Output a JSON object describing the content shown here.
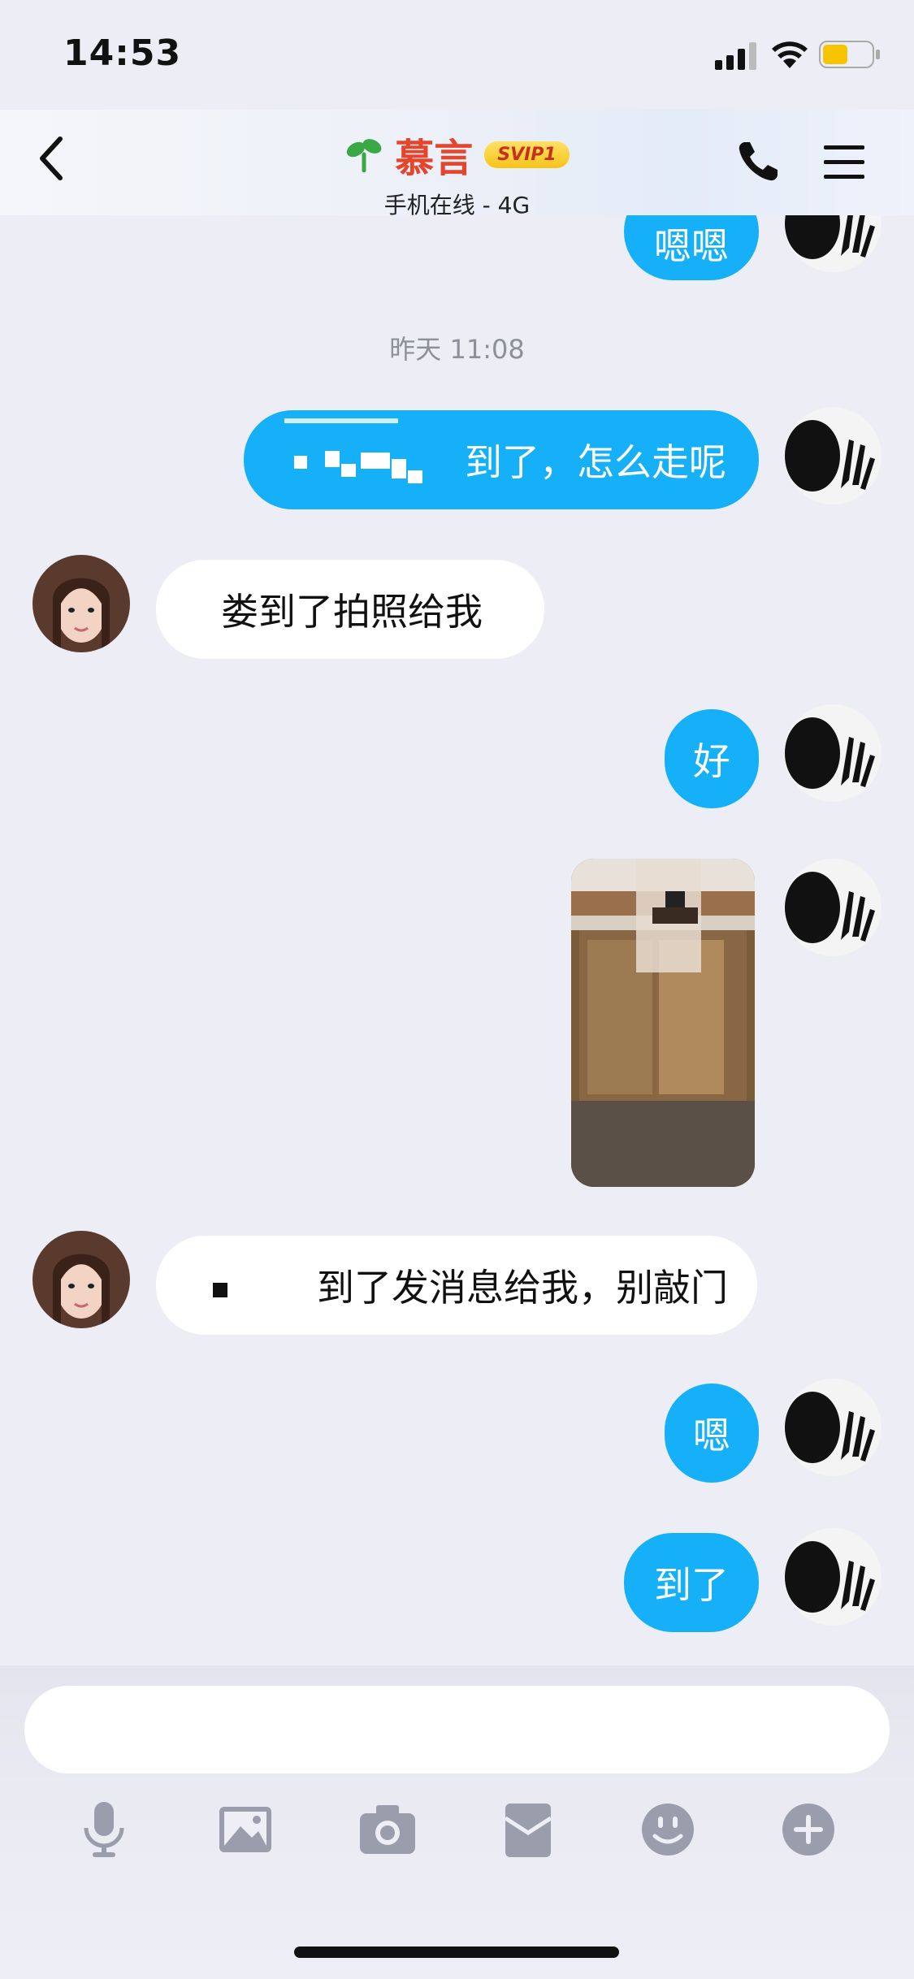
{
  "status": {
    "time": "14:53"
  },
  "header": {
    "name": "慕言",
    "badge": "SVIP1",
    "subtitle": "手机在线 - 4G"
  },
  "messages": [
    {
      "dir": "out",
      "text": "嗯嗯"
    },
    {
      "type": "timestamp",
      "text": "昨天 11:08"
    },
    {
      "dir": "out",
      "text": "到了，怎么走呢"
    },
    {
      "dir": "in",
      "text": "娄到了拍照给我"
    },
    {
      "dir": "out",
      "text": "好"
    },
    {
      "dir": "out",
      "type": "image"
    },
    {
      "dir": "in",
      "text": "到了发消息给我，别敲门"
    },
    {
      "dir": "out",
      "text": "嗯"
    },
    {
      "dir": "out",
      "text": "到了"
    }
  ],
  "toolbar": {
    "icons": [
      "microphone-icon",
      "image-icon",
      "camera-icon",
      "red-packet-icon",
      "emoji-icon",
      "plus-icon"
    ]
  },
  "colors": {
    "outgoing_bubble": "#15b0f8",
    "incoming_bubble": "#ffffff",
    "name": "#e6452d",
    "badge": "#f6c419"
  }
}
